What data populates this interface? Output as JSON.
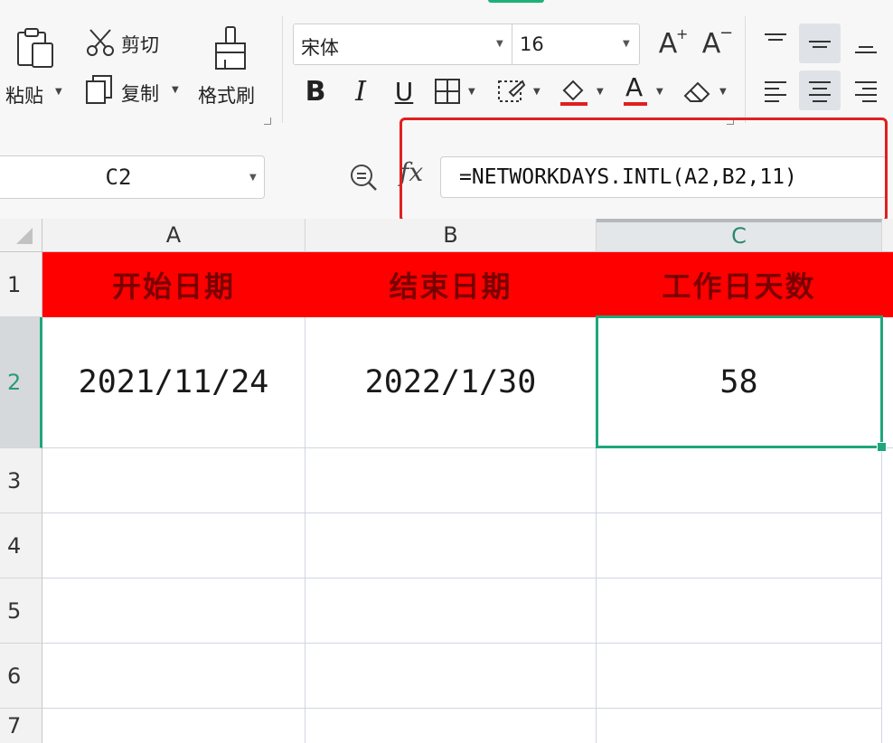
{
  "ribbon": {
    "paste_label": "粘贴",
    "cut_label": "剪切",
    "copy_label": "复制",
    "format_painter_label": "格式刷",
    "font_name": "宋体",
    "font_size": "16",
    "grow_font_glyph": "A",
    "shrink_font_glyph": "A",
    "bold_glyph": "B",
    "italic_glyph": "I",
    "underline_glyph": "U",
    "font_color_glyph": "A",
    "accent_color": "#1fb07a",
    "underline_red": "#e02020"
  },
  "formula_bar": {
    "name_box": "C2",
    "fx_label": "fx",
    "formula": "=NETWORKDAYS.INTL(A2,B2,11)",
    "highlight_color": "#e02020"
  },
  "sheet": {
    "columns": [
      "A",
      "B",
      "C"
    ],
    "rows": [
      "1",
      "2",
      "3",
      "4",
      "5",
      "6",
      "7"
    ],
    "header_row": [
      "开始日期",
      "结束日期",
      "工作日天数"
    ],
    "data_row": [
      "2021/11/24",
      "2022/1/30",
      "58"
    ],
    "selected_cell": "C2",
    "header_fill": "#ff0000",
    "header_text_color": "#7a0000",
    "selection_color": "#1fa77c"
  }
}
